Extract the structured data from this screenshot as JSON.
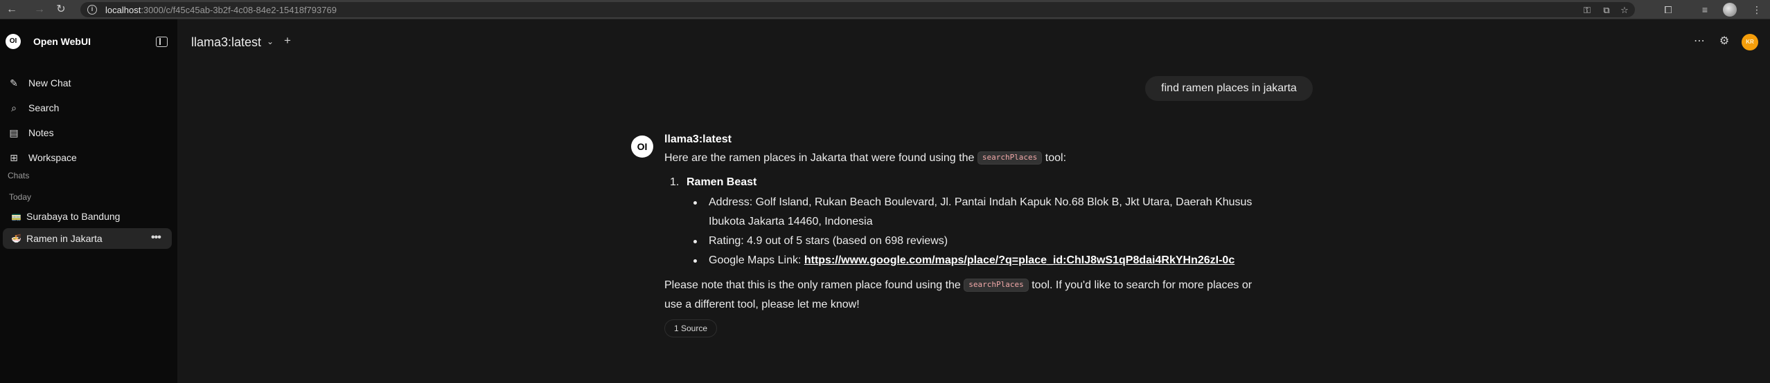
{
  "browser": {
    "url_host": "localhost",
    "url_path": ":3000/c/f45c45ab-3b2f-4c08-84e2-15418f793769"
  },
  "sidebar": {
    "brand": "Open WebUI",
    "logo_text": "OI",
    "nav": [
      {
        "label": "New Chat",
        "icon": "edit-icon"
      },
      {
        "label": "Search",
        "icon": "search-icon"
      },
      {
        "label": "Notes",
        "icon": "notes-icon"
      },
      {
        "label": "Workspace",
        "icon": "workspace-icon"
      }
    ],
    "section_label": "Chats",
    "group_label": "Today",
    "chats": [
      {
        "label": "Surabaya to Bandung",
        "emoji": "🚃",
        "active": false
      },
      {
        "label": "Ramen in Jakarta",
        "emoji": "🍜",
        "active": true
      }
    ]
  },
  "header": {
    "model": "llama3:latest",
    "add_symbol": "+",
    "avatar_initials": "KR"
  },
  "conversation": {
    "user_message": "find ramen places in jakarta",
    "assistant": {
      "avatar_text": "OI",
      "name": "llama3:latest",
      "intro_before": "Here are the ramen places in Jakarta that were found using the",
      "tool_name": "searchPlaces",
      "intro_after": "tool:",
      "list_number": "1.",
      "place_name": "Ramen Beast",
      "address_line1": "Address: Golf Island, Rukan Beach Boulevard, Jl. Pantai Indah Kapuk No.68 Blok B, Jkt Utara, Daerah Khusus",
      "address_line2": "Ibukota Jakarta 14460, Indonesia",
      "rating": "Rating: 4.9 out of 5 stars (based on 698 reviews)",
      "maps_label": "Google Maps Link:",
      "maps_url": "https://www.google.com/maps/place/?q=place_id:ChIJ8wS1qP8dai4RkYHn26zI-0c",
      "outro_before": "Please note that this is the only ramen place found using the",
      "outro_after": "tool. If you'd like to search for more places or",
      "outro_line2": "use a different tool, please let me know!",
      "sources_label": "1 Source"
    }
  }
}
